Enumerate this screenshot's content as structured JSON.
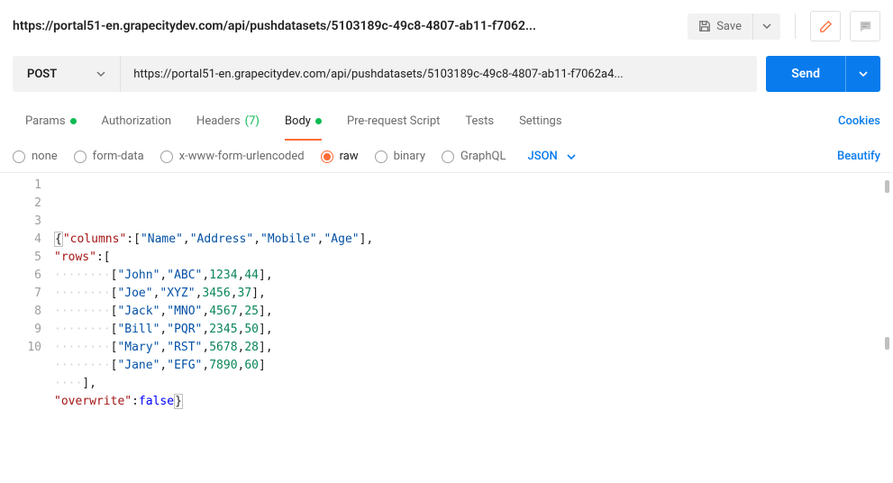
{
  "title": "https://portal51-en.grapecitydev.com/api/pushdatasets/5103189c-49c8-4807-ab11-f7062...",
  "save_label": "Save",
  "method": "POST",
  "url": "https://portal51-en.grapecitydev.com/api/pushdatasets/5103189c-49c8-4807-ab11-f7062a4...",
  "send_label": "Send",
  "tabs": {
    "params": "Params",
    "auth": "Authorization",
    "headers": "Headers",
    "headers_count": "(7)",
    "body": "Body",
    "prereq": "Pre-request Script",
    "tests": "Tests",
    "settings": "Settings"
  },
  "cookies": "Cookies",
  "body_types": {
    "none": "none",
    "formdata": "form-data",
    "xwww": "x-www-form-urlencoded",
    "raw": "raw",
    "binary": "binary",
    "graphql": "GraphQL"
  },
  "raw_format": "JSON",
  "beautify": "Beautify",
  "editor": {
    "lines": [
      "1",
      "2",
      "3",
      "4",
      "5",
      "6",
      "7",
      "8",
      "9",
      "10"
    ],
    "body_json": {
      "columns": [
        "Name",
        "Address",
        "Mobile",
        "Age"
      ],
      "rows": [
        [
          "John",
          "ABC",
          1234,
          44
        ],
        [
          "Joe",
          "XYZ",
          3456,
          37
        ],
        [
          "Jack",
          "MNO",
          4567,
          25
        ],
        [
          "Bill",
          "PQR",
          2345,
          50
        ],
        [
          "Mary",
          "RST",
          5678,
          28
        ],
        [
          "Jane",
          "EFG",
          7890,
          60
        ]
      ],
      "overwrite": false
    }
  }
}
